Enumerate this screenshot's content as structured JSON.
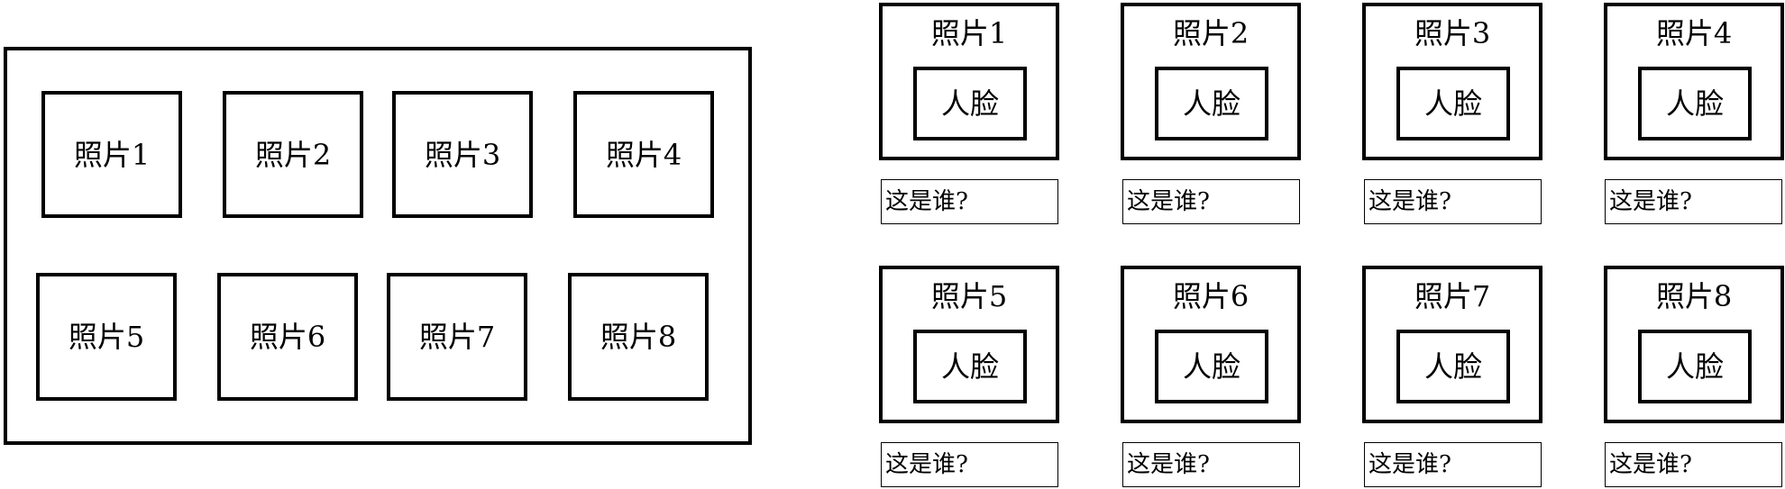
{
  "left_panel": {
    "photos": [
      {
        "label": "照片1"
      },
      {
        "label": "照片2"
      },
      {
        "label": "照片3"
      },
      {
        "label": "照片4"
      },
      {
        "label": "照片5"
      },
      {
        "label": "照片6"
      },
      {
        "label": "照片7"
      },
      {
        "label": "照片8"
      }
    ]
  },
  "right_panel": {
    "cards": [
      {
        "title": "照片1",
        "face": "人脸",
        "caption": "这是谁?"
      },
      {
        "title": "照片2",
        "face": "人脸",
        "caption": "这是谁?"
      },
      {
        "title": "照片3",
        "face": "人脸",
        "caption": "这是谁?"
      },
      {
        "title": "照片4",
        "face": "人脸",
        "caption": "这是谁?"
      },
      {
        "title": "照片5",
        "face": "人脸",
        "caption": "这是谁?"
      },
      {
        "title": "照片6",
        "face": "人脸",
        "caption": "这是谁?"
      },
      {
        "title": "照片7",
        "face": "人脸",
        "caption": "这是谁?"
      },
      {
        "title": "照片8",
        "face": "人脸",
        "caption": "这是谁?"
      }
    ]
  }
}
